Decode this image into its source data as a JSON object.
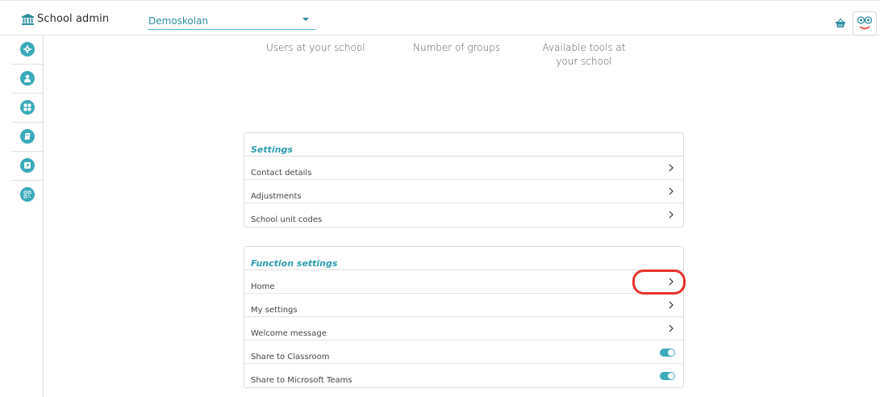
{
  "header": {
    "title": "School admin",
    "school_select": {
      "value": "Demoskolan"
    }
  },
  "sidebar": {
    "items": [
      {
        "icon": "gear-icon"
      },
      {
        "icon": "user-icon"
      },
      {
        "icon": "grid-icon"
      },
      {
        "icon": "book-icon"
      },
      {
        "icon": "external-link-icon"
      },
      {
        "icon": "qr-code-icon"
      }
    ]
  },
  "stats": {
    "users_label": "Users at your school",
    "groups_label": "Number of groups",
    "tools_label_line1": "Available tools at",
    "tools_label_line2": "your school"
  },
  "settings_panel": {
    "title": "Settings",
    "rows": [
      {
        "label": "Contact details"
      },
      {
        "label": "Adjustments"
      },
      {
        "label": "School unit codes"
      }
    ]
  },
  "function_panel": {
    "title": "Function settings",
    "rows": [
      {
        "label": "Home"
      },
      {
        "label": "My settings"
      },
      {
        "label": "Welcome message"
      },
      {
        "label": "Share to Classroom",
        "toggle": true
      },
      {
        "label": "Share to Microsoft Teams",
        "toggle": true
      }
    ]
  },
  "colors": {
    "accent": "#3aaab9",
    "highlight": "#e8332a"
  }
}
